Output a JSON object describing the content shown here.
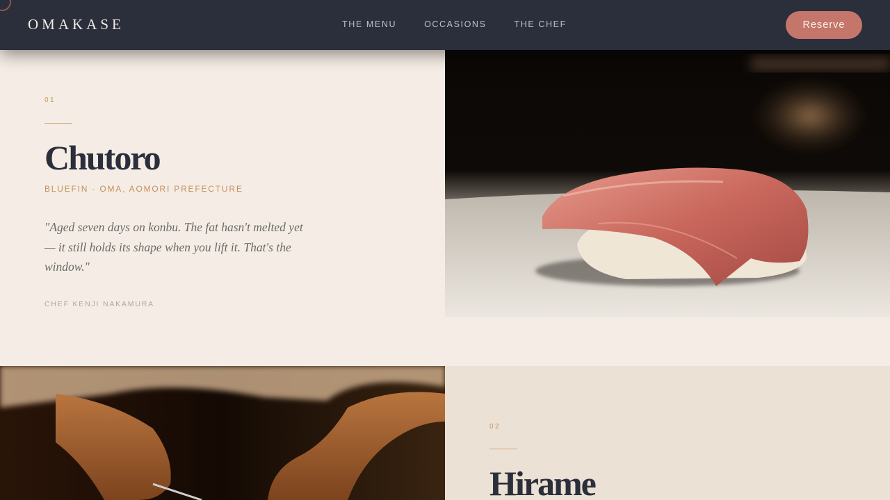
{
  "nav": {
    "brand": "OMAKASE",
    "links": [
      "THE MENU",
      "OCCASIONS",
      "THE CHEF"
    ],
    "reserve_label": "Reserve"
  },
  "dishes": [
    {
      "number": "01",
      "name": "Chutoro",
      "origin": "BLUEFIN · OMA, AOMORI PREFECTURE",
      "quote": "\"Aged seven days on konbu. The fat hasn't melted yet — it still holds its shape when you lift it. That's the window.\"",
      "chef": "CHEF KENJI NAKAMURA"
    },
    {
      "number": "02",
      "name": "Hirame"
    }
  ],
  "colors": {
    "nav_bg": "#2b2e3b",
    "accent": "#c4766b",
    "gold": "#c48f5d",
    "cream": "#f5ede5",
    "sand": "#ebe1d4"
  }
}
